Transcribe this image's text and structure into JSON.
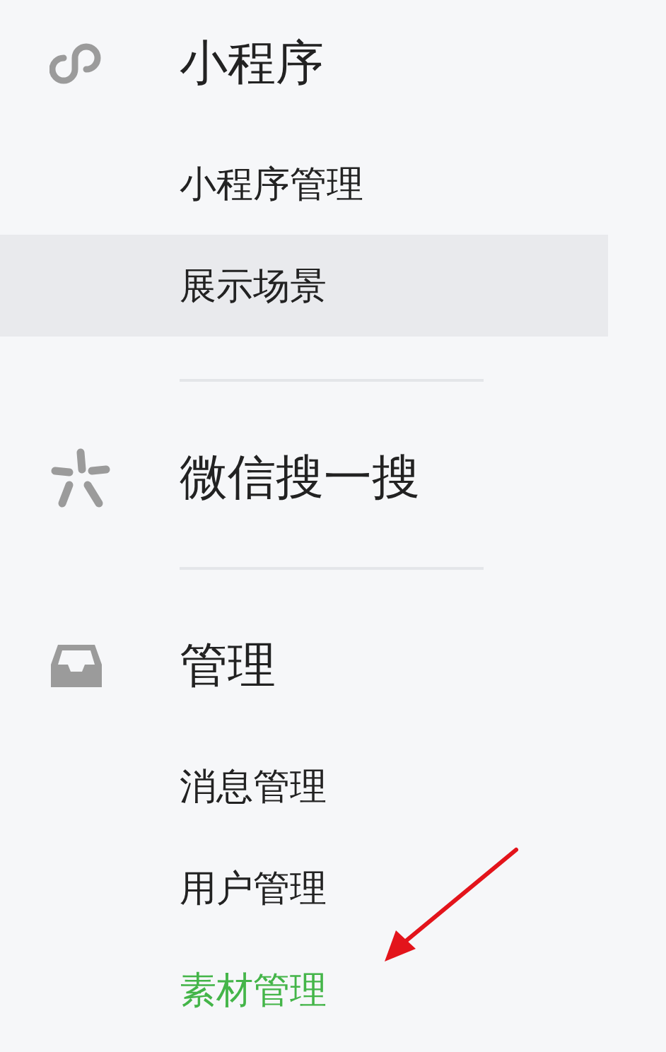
{
  "sidebar": {
    "sections": [
      {
        "title": "小程序",
        "items": [
          {
            "label": "小程序管理",
            "selected": false,
            "highlighted": false
          },
          {
            "label": "展示场景",
            "selected": false,
            "highlighted": true
          }
        ]
      },
      {
        "title": "微信搜一搜"
      },
      {
        "title": "管理",
        "items": [
          {
            "label": "消息管理",
            "selected": false,
            "highlighted": false
          },
          {
            "label": "用户管理",
            "selected": false,
            "highlighted": false
          },
          {
            "label": "素材管理",
            "selected": true,
            "highlighted": false
          }
        ]
      }
    ]
  }
}
